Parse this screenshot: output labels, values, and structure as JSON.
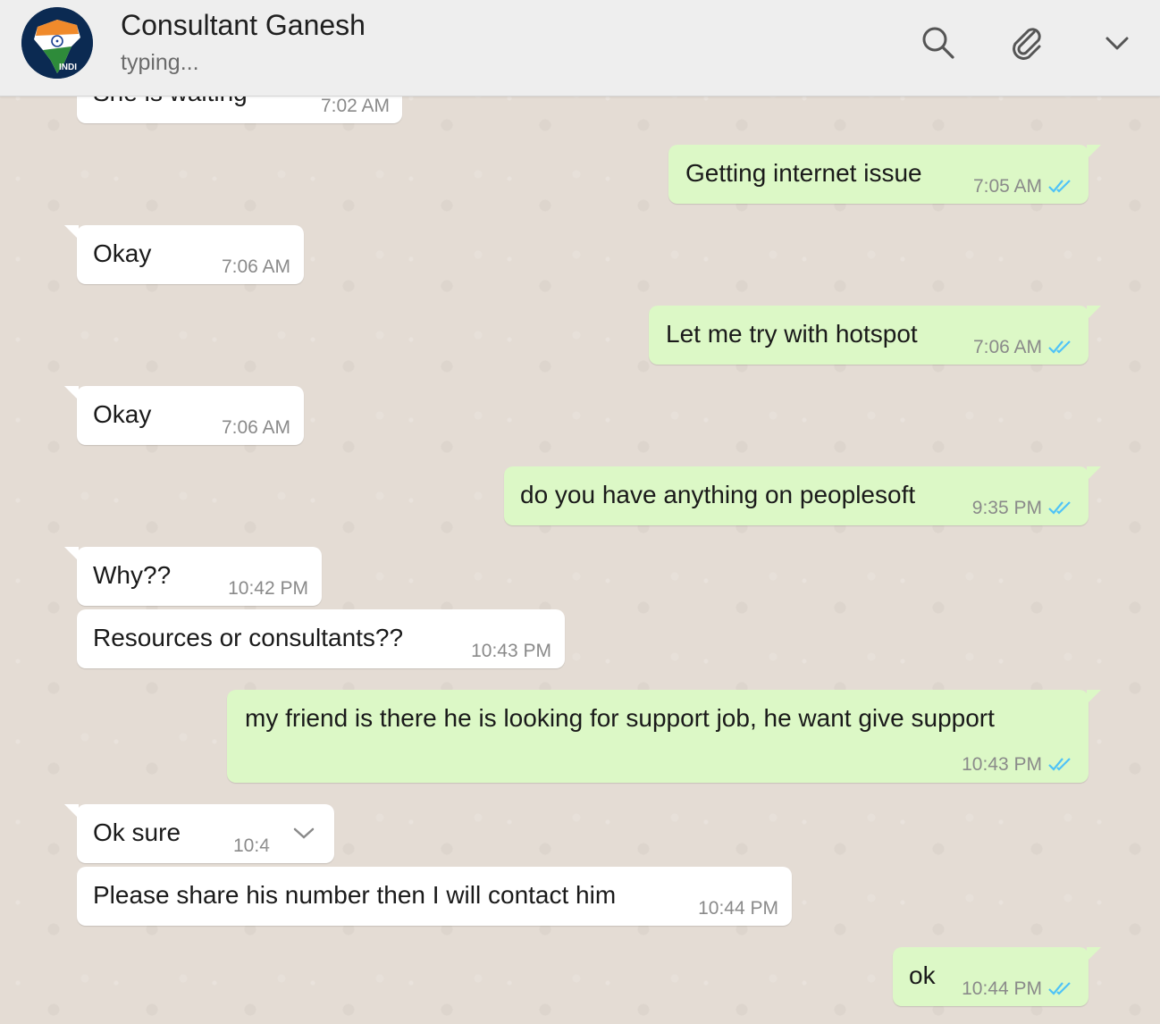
{
  "header": {
    "contact_name": "Consultant Ganesh",
    "status": "typing...",
    "avatar_text": "INDI"
  },
  "messages": [
    {
      "text": "She is waiting",
      "time": "7:02 AM",
      "direction": "incoming"
    },
    {
      "text": "Getting internet issue",
      "time": "7:05 AM",
      "direction": "outgoing",
      "read": true
    },
    {
      "text": "Okay",
      "time": "7:06 AM",
      "direction": "incoming"
    },
    {
      "text": "Let me try with hotspot",
      "time": "7:06 AM",
      "direction": "outgoing",
      "read": true
    },
    {
      "text": "Okay",
      "time": "7:06 AM",
      "direction": "incoming"
    },
    {
      "text": "do you have anything on peoplesoft",
      "time": "9:35 PM",
      "direction": "outgoing",
      "read": true
    },
    {
      "text": "Why??",
      "time": "10:42 PM",
      "direction": "incoming"
    },
    {
      "text": "Resources or consultants??",
      "time": "10:43 PM",
      "direction": "incoming"
    },
    {
      "text": "my friend is there he is looking for support job, he want give support",
      "time": "10:43 PM",
      "direction": "outgoing",
      "read": true
    },
    {
      "text": "Ok sure",
      "time": "10:4",
      "direction": "incoming"
    },
    {
      "text": "Please share his number then I will contact him",
      "time": "10:44 PM",
      "direction": "incoming"
    },
    {
      "text": "ok",
      "time": "10:44 PM",
      "direction": "outgoing",
      "read": true
    }
  ],
  "colors": {
    "incoming_bubble": "#ffffff",
    "outgoing_bubble": "#dcf8c6",
    "read_ticks": "#4fc3f7",
    "header_bg": "#eeeeee",
    "chat_bg": "#e5ddd5"
  },
  "icons": {
    "search": "search-icon",
    "attach": "paperclip-icon",
    "menu": "chevron-down-icon",
    "read_receipt": "double-check-icon"
  }
}
